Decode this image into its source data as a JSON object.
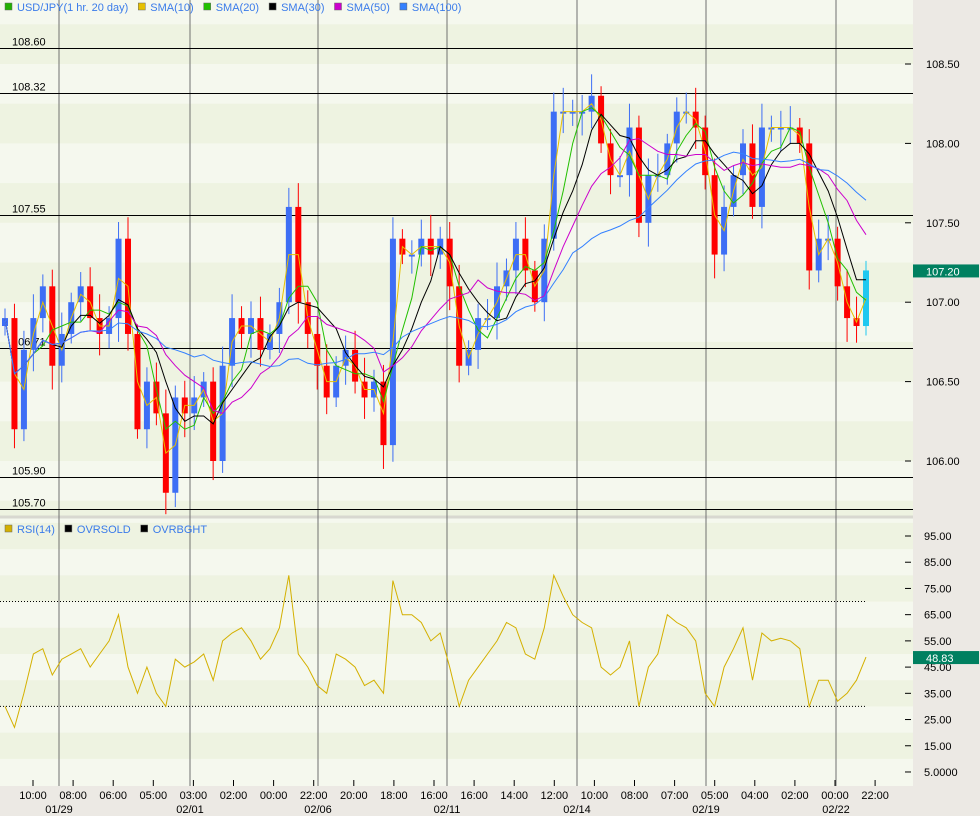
{
  "chart_data": [
    {
      "type": "candlestick",
      "title": "USD/JPY(1 hr. 20 day)",
      "legend": [
        {
          "name": "USD/JPY(1 hr. 20 day)",
          "color": "#22b000"
        },
        {
          "name": "SMA(10)",
          "color": "#e6c000"
        },
        {
          "name": "SMA(20)",
          "color": "#22c000"
        },
        {
          "name": "SMA(30)",
          "color": "#000000"
        },
        {
          "name": "SMA(50)",
          "color": "#cc00cc"
        },
        {
          "name": "SMA(100)",
          "color": "#3380ff"
        }
      ],
      "y_ticks": [
        "108.50",
        "108.00",
        "107.50",
        "107.00",
        "106.50",
        "106.00"
      ],
      "ylim": [
        105.66,
        108.9
      ],
      "last_price": "107.20",
      "levels": [
        "108.60",
        "108.32",
        "107.55",
        "106.71",
        "105.90",
        "105.70"
      ],
      "up_color": "#3d6ef5",
      "down_color": "#ff0000",
      "closes": [
        106.9,
        106.2,
        106.7,
        106.9,
        107.1,
        106.6,
        106.8,
        107.0,
        107.1,
        106.9,
        106.8,
        106.9,
        107.4,
        106.8,
        106.2,
        106.5,
        106.3,
        105.8,
        106.4,
        106.3,
        106.4,
        106.5,
        106.0,
        106.6,
        106.9,
        106.8,
        106.9,
        106.7,
        106.8,
        107.0,
        107.6,
        107.0,
        106.8,
        106.6,
        106.4,
        106.6,
        106.7,
        106.5,
        106.4,
        106.5,
        106.1,
        107.4,
        107.3,
        107.3,
        107.4,
        107.3,
        107.4,
        107.1,
        106.6,
        106.7,
        106.9,
        106.9,
        107.1,
        107.2,
        107.4,
        107.2,
        107.0,
        107.4,
        108.2,
        108.2,
        108.2,
        108.2,
        108.3,
        108.0,
        107.8,
        107.8,
        108.1,
        107.5,
        107.8,
        107.8,
        108.0,
        108.2,
        108.2,
        108.1,
        107.8,
        107.3,
        107.6,
        107.8,
        108.0,
        107.6,
        108.1,
        108.1,
        108.1,
        108.1,
        108.0,
        107.2,
        107.4,
        107.4,
        107.1,
        106.9,
        106.85,
        107.2
      ]
    },
    {
      "type": "line",
      "legend": [
        {
          "name": "RSI(14)",
          "color": "#d4b000"
        },
        {
          "name": "OVRSOLD",
          "color": "#000000"
        },
        {
          "name": "OVRBGHT",
          "color": "#000000"
        }
      ],
      "y_ticks": [
        "95.00",
        "85.00",
        "75.00",
        "65.00",
        "55.00",
        "45.00",
        "35.00",
        "25.00",
        "15.00",
        "5.0000"
      ],
      "ylim": [
        0,
        100
      ],
      "overbought": 70,
      "oversold": 30,
      "last_value": "48.83",
      "values": [
        30,
        22,
        35,
        50,
        52,
        42,
        48,
        50,
        52,
        45,
        50,
        55,
        65,
        45,
        35,
        45,
        35,
        30,
        48,
        45,
        47,
        50,
        40,
        55,
        58,
        60,
        55,
        48,
        52,
        60,
        80,
        50,
        45,
        38,
        35,
        50,
        48,
        45,
        38,
        40,
        35,
        78,
        65,
        65,
        62,
        55,
        58,
        45,
        30,
        40,
        45,
        50,
        55,
        62,
        60,
        50,
        48,
        60,
        80,
        72,
        65,
        62,
        60,
        45,
        42,
        45,
        55,
        30,
        45,
        50,
        65,
        62,
        60,
        55,
        35,
        30,
        45,
        52,
        60,
        40,
        58,
        55,
        56,
        55,
        52,
        30,
        40,
        40,
        32,
        35,
        40,
        48.83
      ]
    }
  ],
  "time_axis": {
    "times": [
      "10:00",
      "08:00",
      "06:00",
      "05:00",
      "03:00",
      "02:00",
      "00:00",
      "22:00",
      "20:00",
      "18:00",
      "16:00",
      "16:00",
      "14:00",
      "12:00",
      "10:00",
      "08:00",
      "07:00",
      "05:00",
      "04:00",
      "02:00",
      "00:00",
      "22:00"
    ],
    "dates": [
      "01/29",
      "02/01",
      "02/06",
      "02/11",
      "02/14",
      "02/19",
      "02/22"
    ]
  }
}
